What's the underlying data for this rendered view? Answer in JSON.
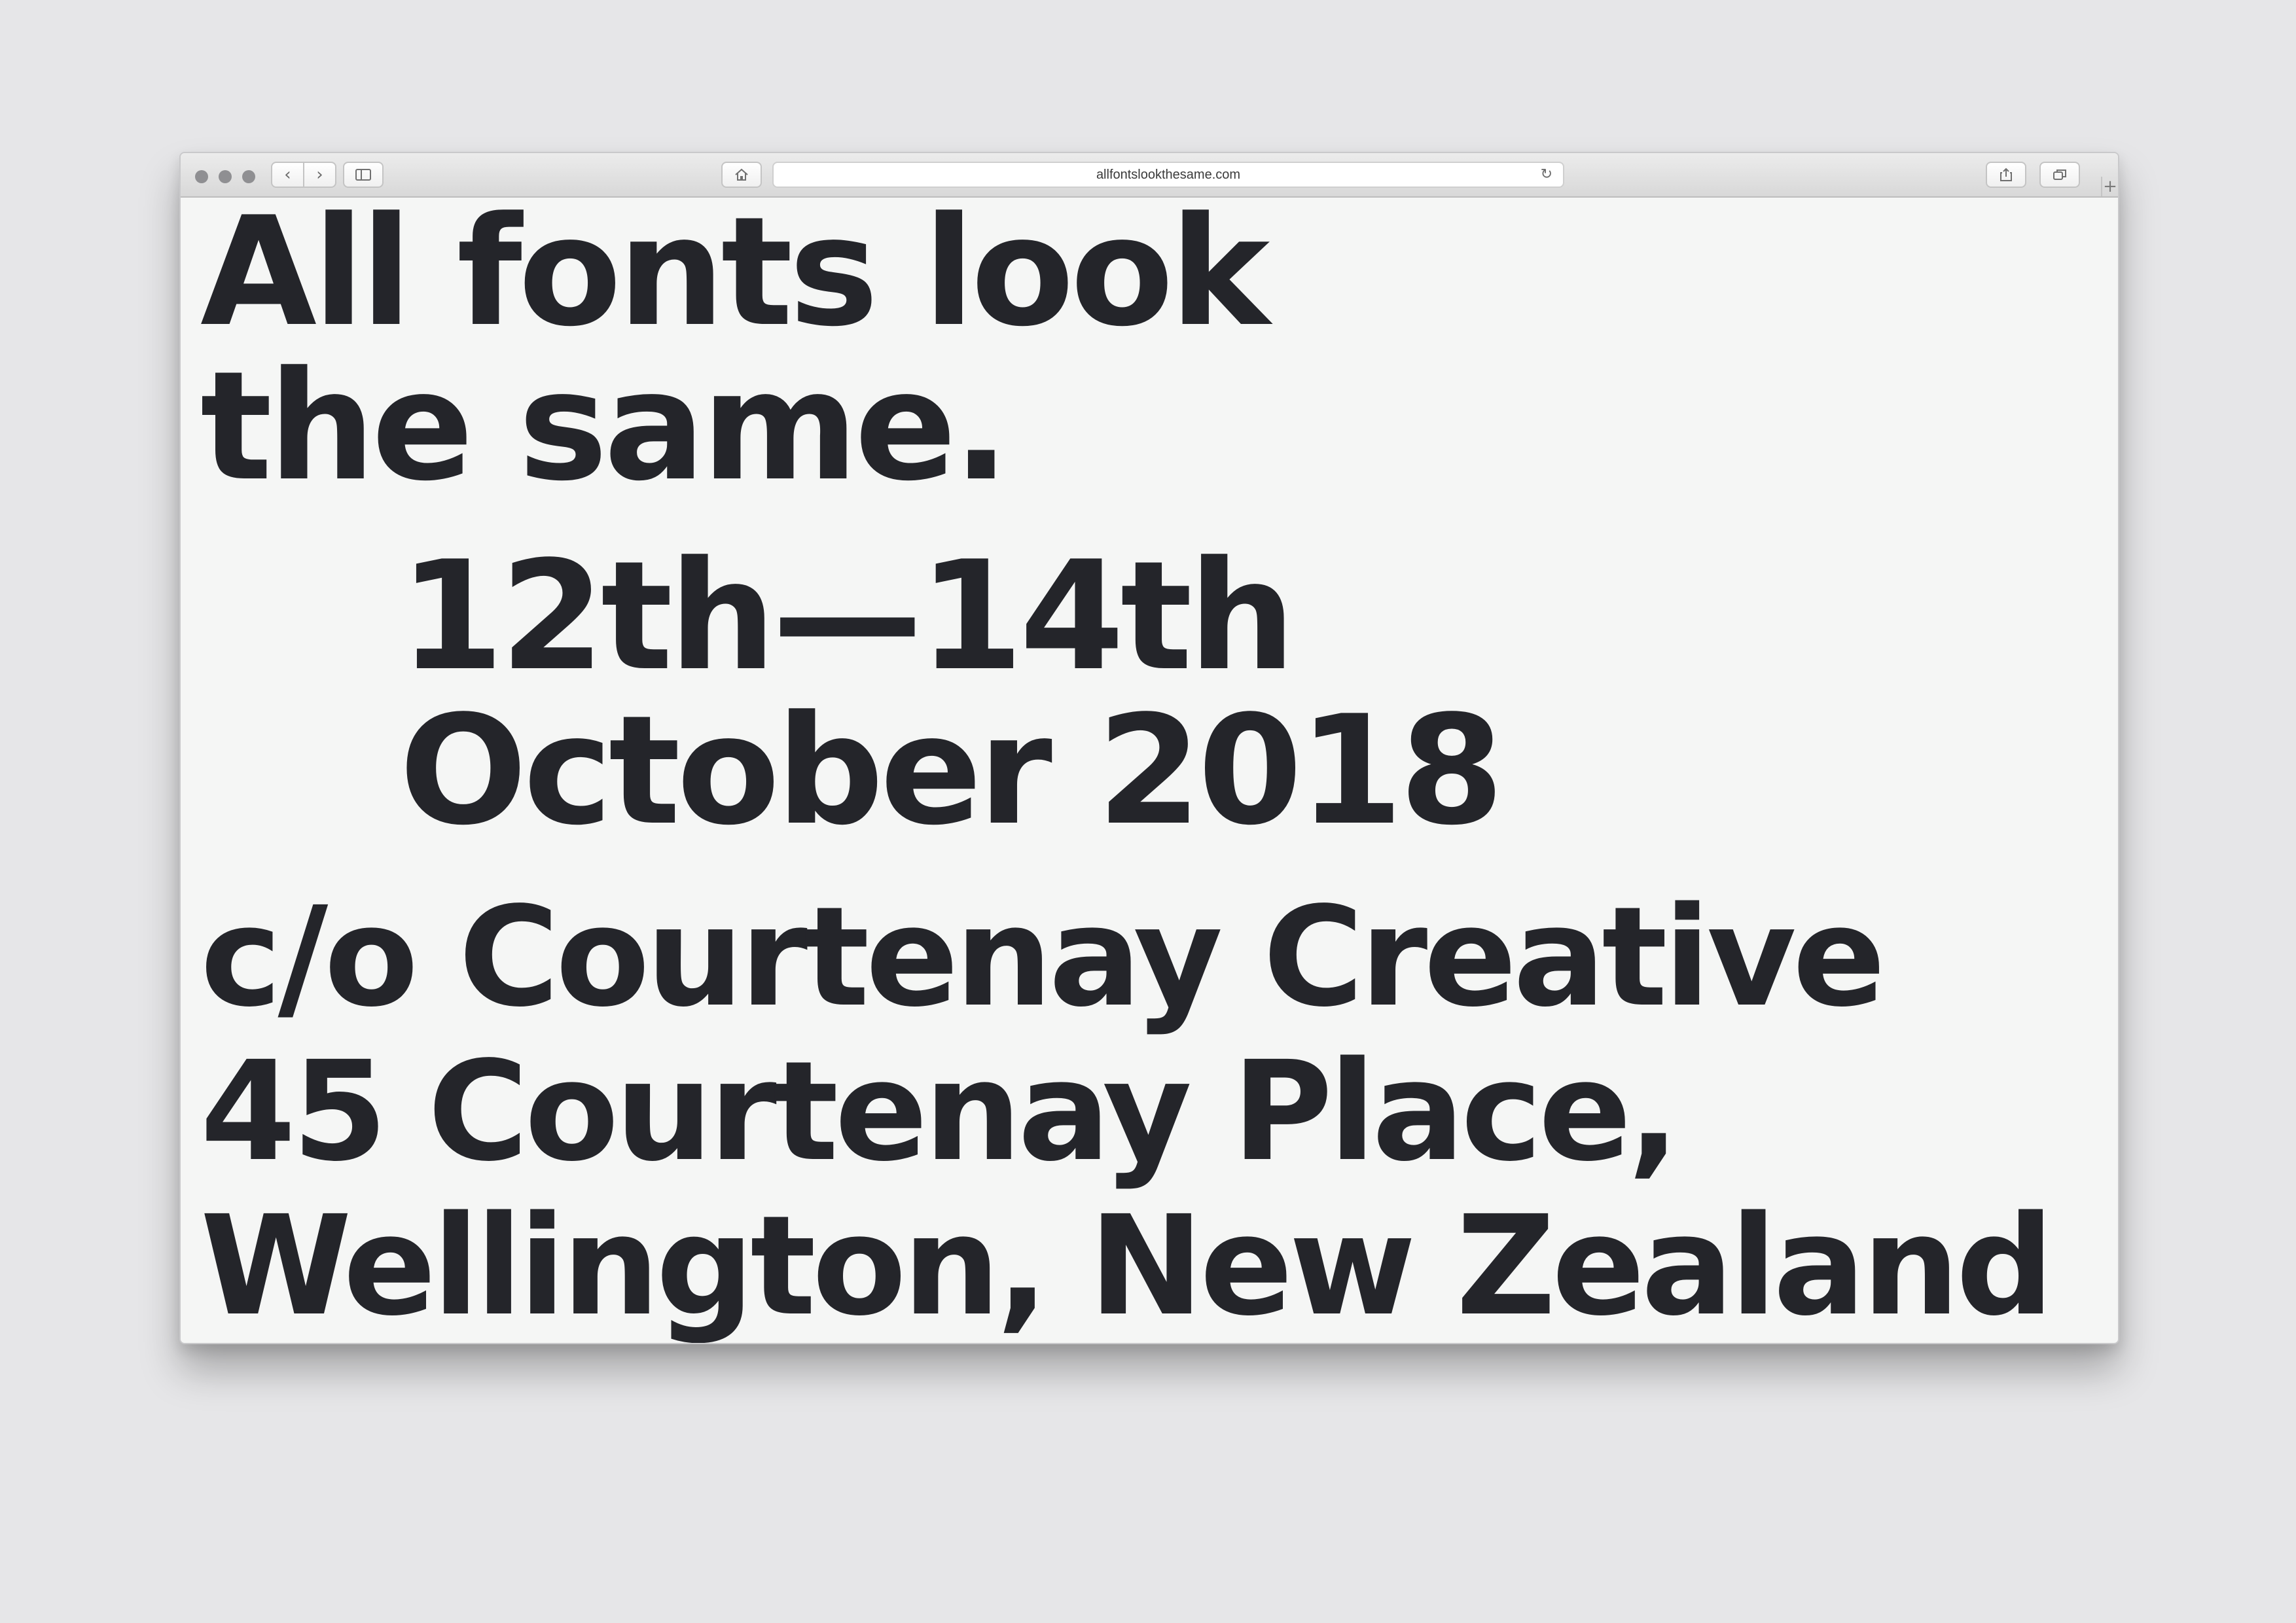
{
  "browser": {
    "url": "allfontslookthesame.com"
  },
  "content": {
    "lines": [
      "All fonts look",
      "the same.",
      "12th—14th",
      "October 2018",
      "c/o Courtenay Creative",
      "45 Courtenay Place,",
      "Wellington, New Zealand"
    ]
  }
}
